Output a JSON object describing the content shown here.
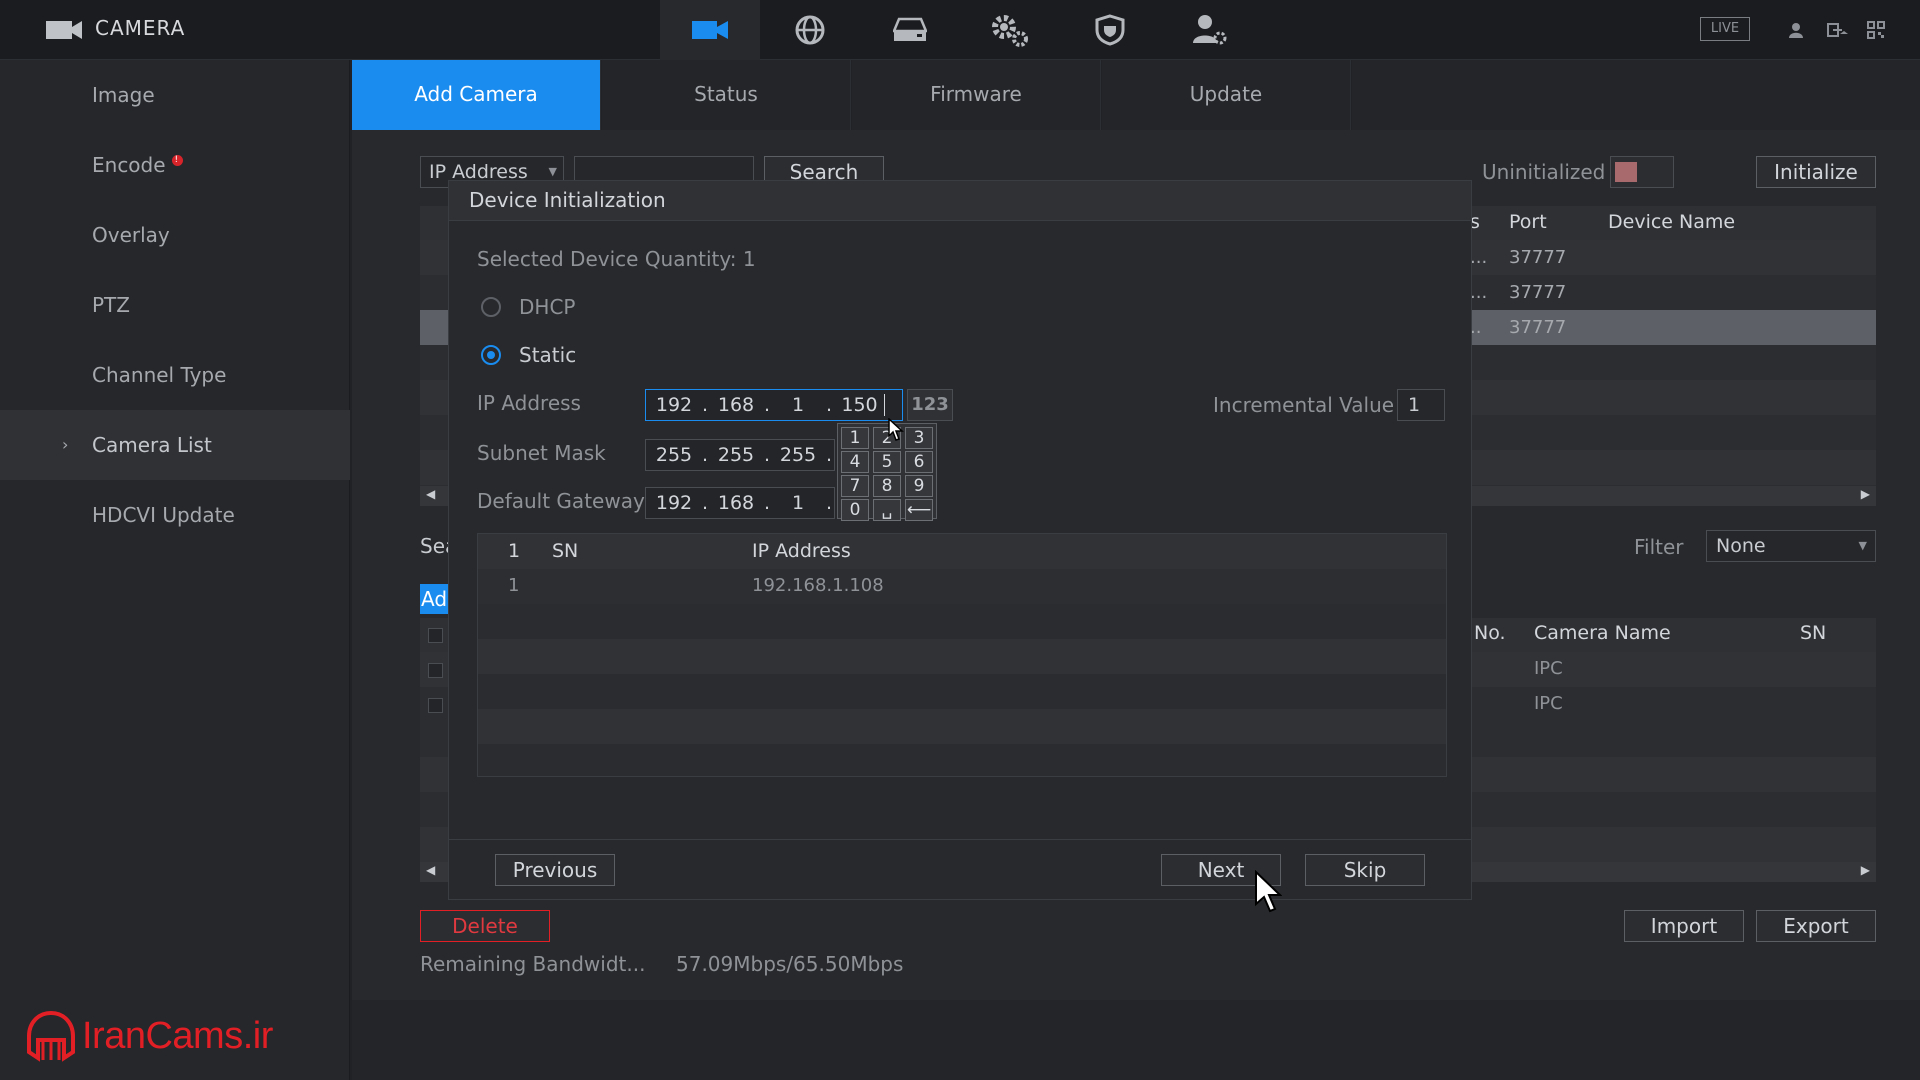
{
  "app": {
    "title": "CAMERA",
    "live": "LIVE"
  },
  "nav_icons": [
    "camera-icon",
    "network-icon",
    "storage-icon",
    "settings-icon",
    "security-icon",
    "account-icon"
  ],
  "sidebar": {
    "items": [
      {
        "label": "Image"
      },
      {
        "label": "Encode"
      },
      {
        "label": "Overlay"
      },
      {
        "label": "PTZ"
      },
      {
        "label": "Channel Type"
      },
      {
        "label": "Camera List",
        "active": true
      },
      {
        "label": "HDCVI Update"
      }
    ]
  },
  "tabs": [
    {
      "label": "Add Camera",
      "active": true
    },
    {
      "label": "Status"
    },
    {
      "label": "Firmware"
    },
    {
      "label": "Update"
    }
  ],
  "search_bar": {
    "filter_select": "IP Address",
    "search_label": "Search",
    "uninitialized_label": "Uninitialized",
    "initialize_label": "Initialize"
  },
  "device_table": {
    "columns": [
      "s",
      "Port",
      "Device Name"
    ],
    "rows": [
      {
        "c": "...",
        "port": "37777"
      },
      {
        "c": "...",
        "port": "37777"
      },
      {
        "c": "..",
        "port": "37777"
      }
    ]
  },
  "added_section": {
    "search_fragment": "Sea",
    "add_fragment": "Ad",
    "filter_label": "Filter",
    "filter_value": "None",
    "columns": [
      "No.",
      "Camera Name",
      "SN"
    ],
    "rows": [
      {
        "name": "IPC"
      },
      {
        "name": "IPC"
      }
    ]
  },
  "bottom": {
    "delete_label": "Delete",
    "bandwidth_label": "Remaining Bandwidt...",
    "bandwidth_value": "57.09Mbps/65.50Mbps",
    "import_label": "Import",
    "export_label": "Export"
  },
  "dialog": {
    "title": "Device Initialization",
    "selected_qty": "Selected Device Quantity: 1",
    "dhcp_label": "DHCP",
    "static_label": "Static",
    "ip_label": "IP Address",
    "ip": [
      "192",
      "168",
      "1",
      "150"
    ],
    "mode_badge": "123",
    "subnet_label": "Subnet Mask",
    "subnet": [
      "255",
      "255",
      "255"
    ],
    "gateway_label": "Default Gateway",
    "gateway": [
      "192",
      "168",
      "1"
    ],
    "incremental_label": "Incremental Value",
    "incremental_value": "1",
    "keypad": [
      "1",
      "2",
      "3",
      "4",
      "5",
      "6",
      "7",
      "8",
      "9",
      "0",
      "␣",
      "⟵"
    ],
    "table": {
      "columns": [
        "1",
        "SN",
        "IP Address"
      ],
      "rows": [
        {
          "idx": "1",
          "sn": "",
          "ip": "192.168.1.108"
        }
      ]
    },
    "previous_label": "Previous",
    "next_label": "Next",
    "skip_label": "Skip"
  },
  "brand": {
    "text": "IranCams.ir"
  },
  "colors": {
    "accent": "#1a8cf0",
    "danger": "#e31f26"
  }
}
